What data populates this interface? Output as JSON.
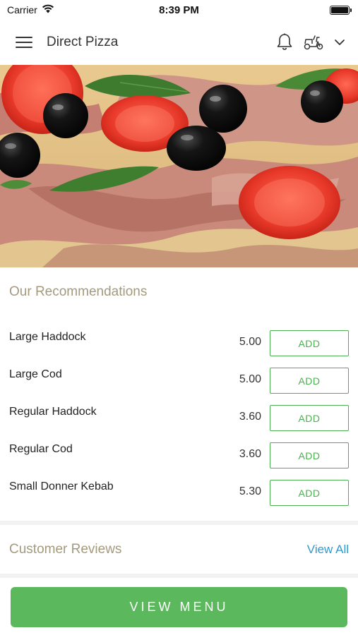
{
  "status_bar": {
    "carrier": "Carrier",
    "time": "8:39 PM"
  },
  "header": {
    "title": "Direct Pizza",
    "icons": [
      "menu-icon",
      "bell-icon",
      "scooter-icon",
      "chevron-down-icon"
    ]
  },
  "hero": {
    "image": "pizza with tomatoes, olives, basil and prosciutto"
  },
  "recommendations": {
    "title": "Our Recommendations",
    "items": [
      {
        "name": "Large Haddock",
        "price": "5.00",
        "button": "ADD"
      },
      {
        "name": "Large Cod",
        "price": "5.00",
        "button": "ADD"
      },
      {
        "name": "Regular Haddock",
        "price": "3.60",
        "button": "ADD"
      },
      {
        "name": "Regular Cod",
        "price": "3.60",
        "button": "ADD"
      },
      {
        "name": "Small Donner Kebab",
        "price": "5.30",
        "button": "ADD"
      }
    ]
  },
  "reviews": {
    "title": "Customer Reviews",
    "view_all": "View All"
  },
  "footer": {
    "button": "VIEW MENU"
  },
  "colors": {
    "accent_green": "#5cb85c",
    "section_title": "#a39a7e",
    "link_blue": "#2e9ad0"
  }
}
